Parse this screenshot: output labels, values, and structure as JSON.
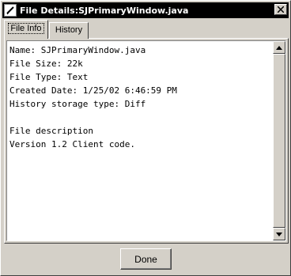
{
  "window": {
    "title": "File Details:SJPrimaryWindow.java"
  },
  "tabs": [
    {
      "label": "File Info",
      "active": true
    },
    {
      "label": "History",
      "active": false
    }
  ],
  "content": {
    "lines": [
      "Name: SJPrimaryWindow.java",
      "File Size: 22k",
      "File Type: Text",
      "Created Date: 1/25/02 6:46:59 PM",
      "History storage type: Diff",
      "",
      "File description",
      "Version 1.2 Client code."
    ]
  },
  "buttons": {
    "done": "Done"
  },
  "icons": {
    "app": "pen-icon",
    "close": "close-icon",
    "scroll_up": "arrow-up-icon",
    "scroll_down": "arrow-down-icon"
  },
  "colors": {
    "titlebar": "#000000",
    "face": "#d4d0c8",
    "content_bg": "#ffffff"
  }
}
